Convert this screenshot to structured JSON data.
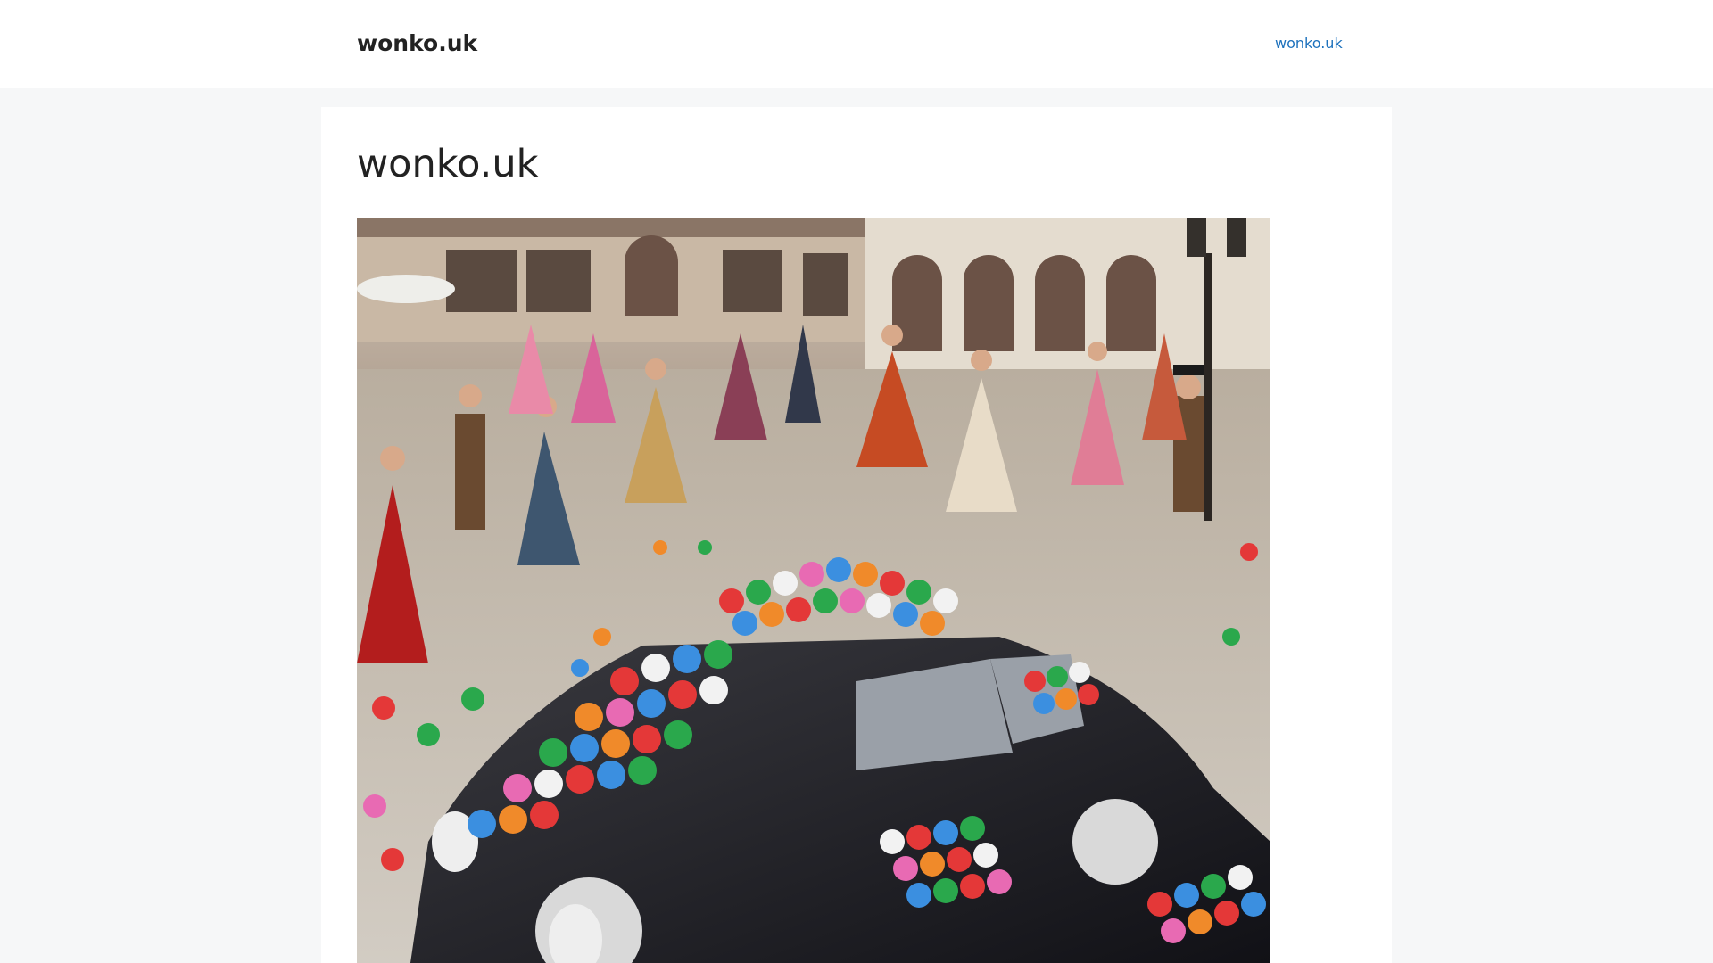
{
  "site": {
    "title": "wonko.uk"
  },
  "nav": {
    "items": [
      {
        "label": "wonko.uk"
      }
    ]
  },
  "page": {
    "title": "wonko.uk",
    "image": {
      "subject-icon": "image-icon"
    }
  },
  "colors": {
    "link": "#1e72bd",
    "page_background": "#f6f7f8",
    "header_background": "#ffffff",
    "text": "#222222"
  }
}
